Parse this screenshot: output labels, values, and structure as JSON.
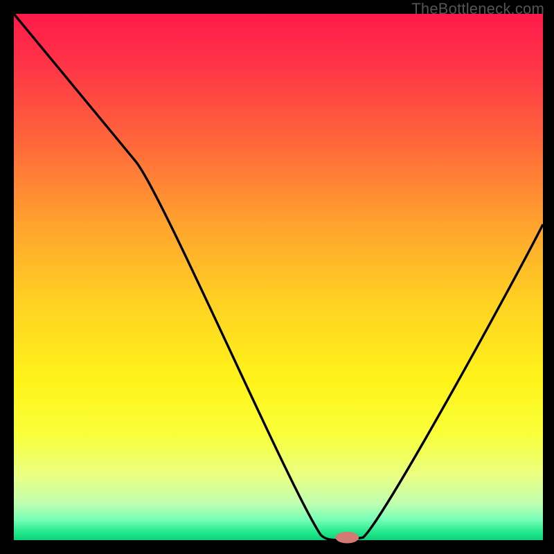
{
  "watermark": "TheBottleneck.com",
  "colors": {
    "gradient_top": "#ff1a4a",
    "gradient_bottom": "#0fce78",
    "curve": "#000000",
    "marker": "#d47a74",
    "axis": "#000000"
  },
  "chart_data": {
    "type": "line",
    "title": "",
    "xlabel": "",
    "ylabel": "",
    "xlim": [
      0,
      100
    ],
    "ylim": [
      0,
      100
    ],
    "series": [
      {
        "name": "bottleneck-curve",
        "x": [
          0,
          10,
          23,
          55,
          58,
          60,
          63,
          67,
          100
        ],
        "values": [
          100,
          85,
          72,
          6,
          1,
          0,
          0,
          1,
          60
        ]
      }
    ],
    "marker": {
      "x": 63,
      "y": 0,
      "rx": 2.2,
      "ry": 1.1
    },
    "grid": false,
    "legend": false
  }
}
